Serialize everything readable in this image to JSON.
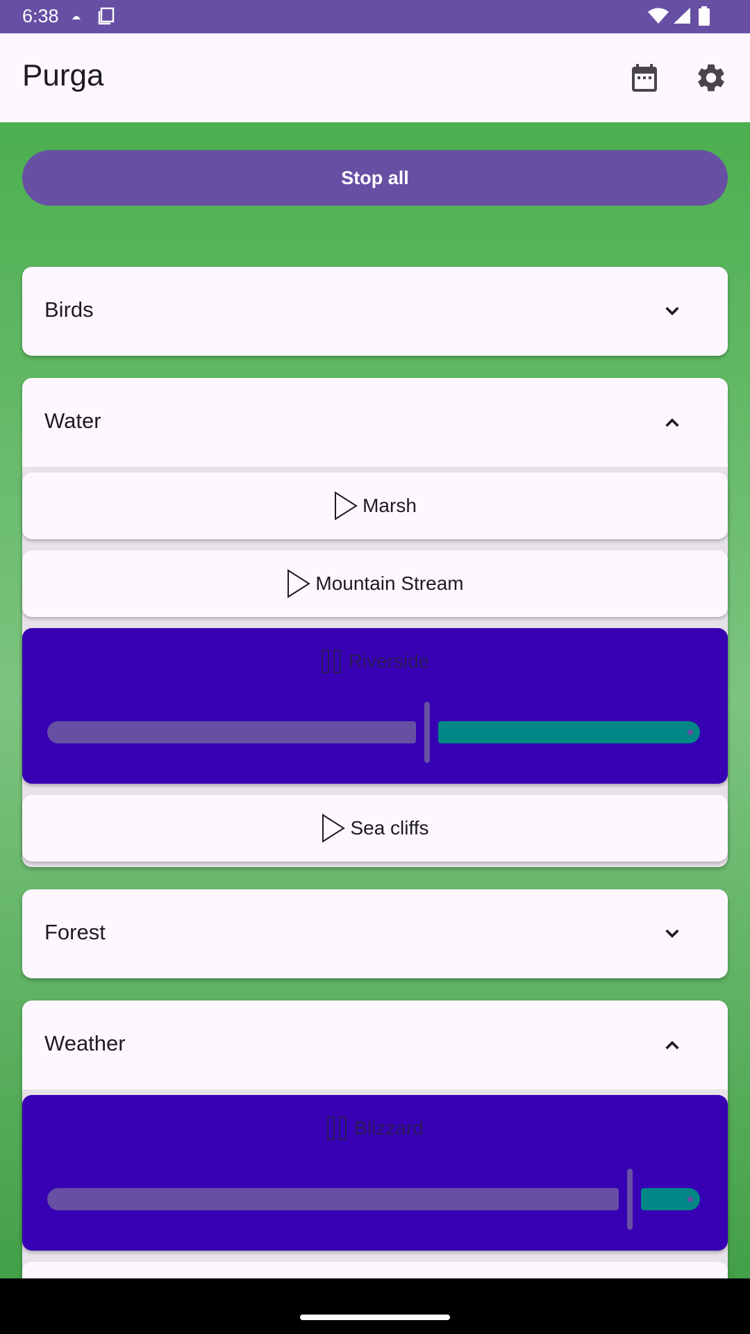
{
  "status_bar": {
    "time": "6:38"
  },
  "app_bar": {
    "title": "Purga",
    "icons": [
      "calendar-icon",
      "settings-icon"
    ]
  },
  "stop_all": {
    "label": "Stop all"
  },
  "categories": [
    {
      "label": "Birds",
      "expanded": false
    },
    {
      "label": "Water",
      "expanded": true,
      "sounds": [
        {
          "name": "Marsh",
          "playing": false
        },
        {
          "name": "Mountain Stream",
          "playing": false
        },
        {
          "name": "Riverside",
          "playing": true,
          "volume_fraction": 0.56
        },
        {
          "name": "Sea cliffs",
          "playing": false
        }
      ]
    },
    {
      "label": "Forest",
      "expanded": false
    },
    {
      "label": "Weather",
      "expanded": true,
      "sounds": [
        {
          "name": "Blizzard",
          "playing": true,
          "volume_fraction": 0.86
        }
      ]
    }
  ],
  "colors": {
    "primary": "#6750a4",
    "playing_card": "#3700b3",
    "slider_track": "#018786",
    "card_bg": "#fef7ff",
    "background_green": "#5cb860"
  }
}
